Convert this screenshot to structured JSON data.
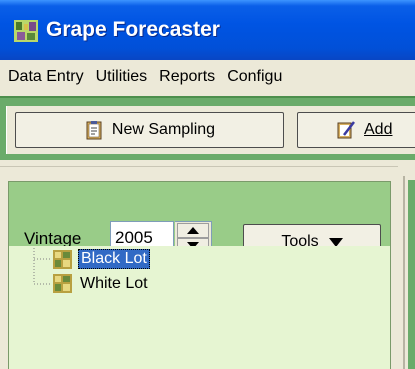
{
  "window": {
    "title": "Grape Forecaster",
    "icon": "grape-app-icon"
  },
  "menu": [
    {
      "label": "Data Entry"
    },
    {
      "label": "Utilities"
    },
    {
      "label": "Reports"
    },
    {
      "label": "Configu"
    }
  ],
  "toolbar": {
    "new_sampling": {
      "label": "New Sampling",
      "icon": "clipboard-icon"
    },
    "add": {
      "label": "Add",
      "icon": "edit-icon"
    }
  },
  "vintage": {
    "label": "Vintage",
    "value": "2005"
  },
  "tools": {
    "label": "Tools"
  },
  "tree": [
    {
      "label": "Black Lot",
      "selected": true
    },
    {
      "label": "White Lot",
      "selected": false
    }
  ],
  "colors": {
    "titlebar": "#0054e3",
    "toolbar_band": "#6aab6a",
    "pane_header": "#99cc88",
    "tree_bg": "#e6f5d2",
    "selection": "#316ac5"
  }
}
